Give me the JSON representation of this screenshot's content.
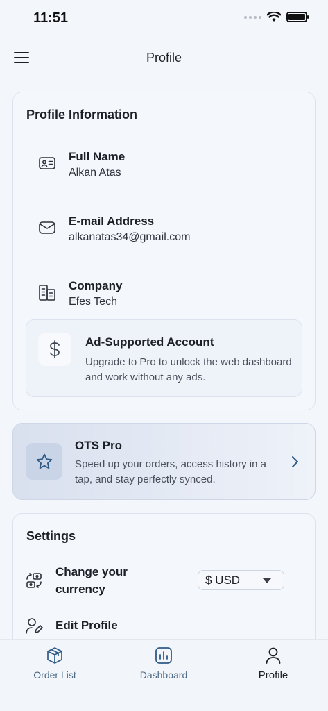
{
  "status_bar": {
    "time": "11:51"
  },
  "header": {
    "title": "Profile"
  },
  "profile_card": {
    "title": "Profile Information",
    "fields": [
      {
        "label": "Full Name",
        "value": "Alkan Atas",
        "icon": "id-card-icon"
      },
      {
        "label": "E-mail Address",
        "value": "alkanatas34@gmail.com",
        "icon": "mail-icon"
      },
      {
        "label": "Company",
        "value": "Efes Tech",
        "icon": "building-icon"
      }
    ],
    "ad_notice": {
      "title": "Ad-Supported Account",
      "description": "Upgrade to Pro to unlock the web dashboard and work without any ads.",
      "icon": "dollar-icon"
    }
  },
  "pro_card": {
    "title": "OTS Pro",
    "description": "Speed up your orders, access history in a tap, and stay perfectly synced.",
    "icon": "star-icon"
  },
  "settings": {
    "title": "Settings",
    "currency_label": "Change your currency",
    "currency_value": "$ USD",
    "edit_profile_label": "Edit Profile"
  },
  "tabs": [
    {
      "label": "Order List",
      "icon": "box-icon",
      "active": false
    },
    {
      "label": "Dashboard",
      "icon": "chart-icon",
      "active": false
    },
    {
      "label": "Profile",
      "icon": "user-icon",
      "active": true
    }
  ],
  "colors": {
    "background": "#f3f6fb",
    "accent": "#2f5b86",
    "tab_inactive": "#4b6a86"
  }
}
